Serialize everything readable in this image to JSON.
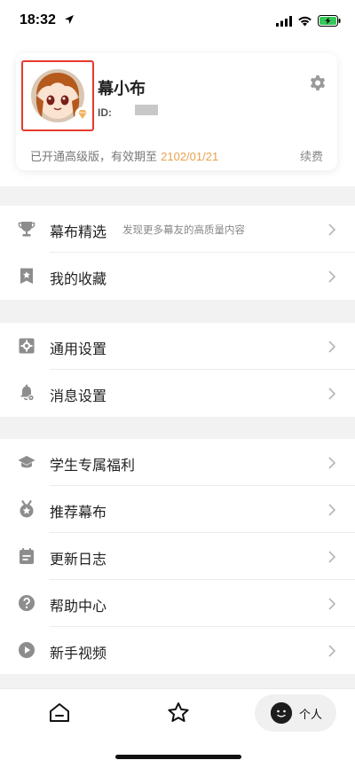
{
  "status_bar": {
    "time": "18:32",
    "icons": [
      "location-arrow-icon",
      "signal-icon",
      "wifi-icon",
      "battery-charging-icon"
    ]
  },
  "profile": {
    "name": "幕小布",
    "id_label": "ID:",
    "vip_prefix": "已开通高级版，有效期至 ",
    "vip_date": "2102/01/21",
    "renew_label": "续费",
    "accent_color": "#e7a24e"
  },
  "menu_groups": [
    {
      "items": [
        {
          "label": "幕布精选",
          "sub": "发现更多幕友的高质量内容",
          "icon": "trophy-icon"
        },
        {
          "label": "我的收藏",
          "sub": "",
          "icon": "bookmark-star-icon"
        }
      ]
    },
    {
      "items": [
        {
          "label": "通用设置",
          "sub": "",
          "icon": "gear-icon"
        },
        {
          "label": "消息设置",
          "sub": "",
          "icon": "bell-settings-icon"
        }
      ]
    },
    {
      "items": [
        {
          "label": "学生专属福利",
          "sub": "",
          "icon": "graduation-cap-icon"
        },
        {
          "label": "推荐幕布",
          "sub": "",
          "icon": "medal-icon"
        },
        {
          "label": "更新日志",
          "sub": "",
          "icon": "calendar-log-icon"
        },
        {
          "label": "帮助中心",
          "sub": "",
          "icon": "help-circle-icon"
        },
        {
          "label": "新手视频",
          "sub": "",
          "icon": "play-circle-icon"
        }
      ]
    }
  ],
  "tab_bar": {
    "tabs": [
      {
        "name": "home-tab",
        "icon": "home-icon",
        "label": ""
      },
      {
        "name": "favorites-tab",
        "icon": "star-icon",
        "label": ""
      },
      {
        "name": "profile-tab",
        "icon": "smiley-face-icon",
        "label": "个人"
      }
    ],
    "active": "profile-tab"
  }
}
